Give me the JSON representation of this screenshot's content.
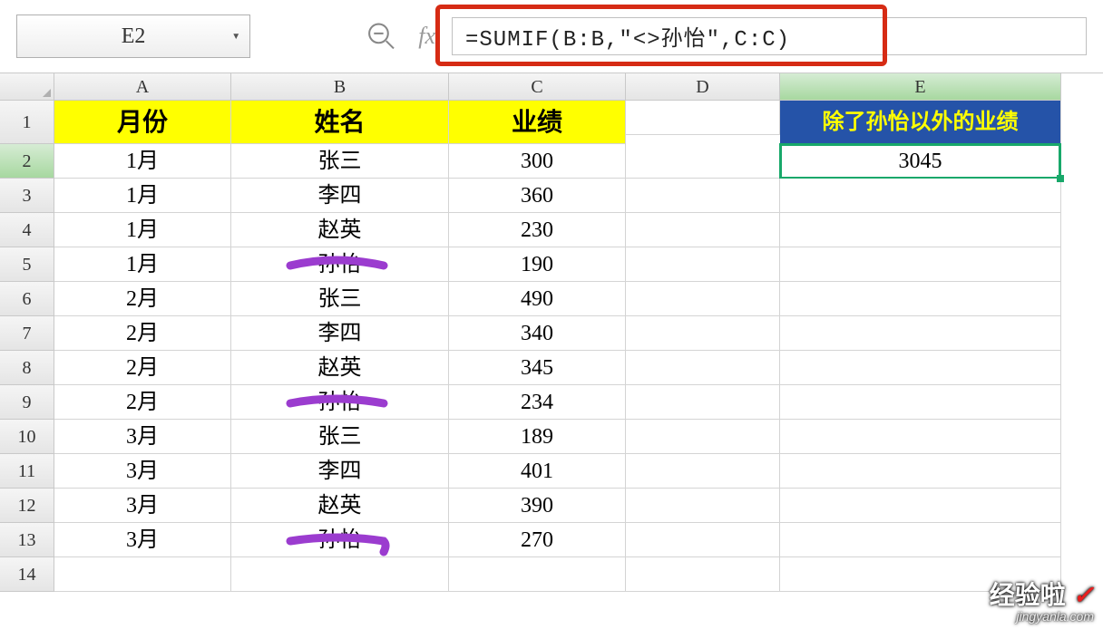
{
  "name_box": {
    "value": "E2"
  },
  "fx_label": "fx",
  "formula_bar": {
    "value": "=SUMIF(B:B,\"<>孙怡\",C:C)"
  },
  "columns": [
    "A",
    "B",
    "C",
    "D",
    "E"
  ],
  "headers": {
    "A": "月份",
    "B": "姓名",
    "C": "业绩",
    "E": "除了孙怡以外的业绩"
  },
  "active_cell": {
    "ref": "E2",
    "value": "3045"
  },
  "rows": [
    {
      "r": 2,
      "A": "1月",
      "B": "张三",
      "C": "300"
    },
    {
      "r": 3,
      "A": "1月",
      "B": "李四",
      "C": "360"
    },
    {
      "r": 4,
      "A": "1月",
      "B": "赵英",
      "C": "230"
    },
    {
      "r": 5,
      "A": "1月",
      "B": "孙怡",
      "C": "190"
    },
    {
      "r": 6,
      "A": "2月",
      "B": "张三",
      "C": "490"
    },
    {
      "r": 7,
      "A": "2月",
      "B": "李四",
      "C": "340"
    },
    {
      "r": 8,
      "A": "2月",
      "B": "赵英",
      "C": "345"
    },
    {
      "r": 9,
      "A": "2月",
      "B": "孙怡",
      "C": "234"
    },
    {
      "r": 10,
      "A": "3月",
      "B": "张三",
      "C": "189"
    },
    {
      "r": 11,
      "A": "3月",
      "B": "李四",
      "C": "401"
    },
    {
      "r": 12,
      "A": "3月",
      "B": "赵英",
      "C": "390"
    },
    {
      "r": 13,
      "A": "3月",
      "B": "孙怡",
      "C": "270"
    },
    {
      "r": 14,
      "A": "",
      "B": "",
      "C": ""
    }
  ],
  "watermark": {
    "line1": "经验啦",
    "check": "✓",
    "line2": "jingyanla.com"
  }
}
